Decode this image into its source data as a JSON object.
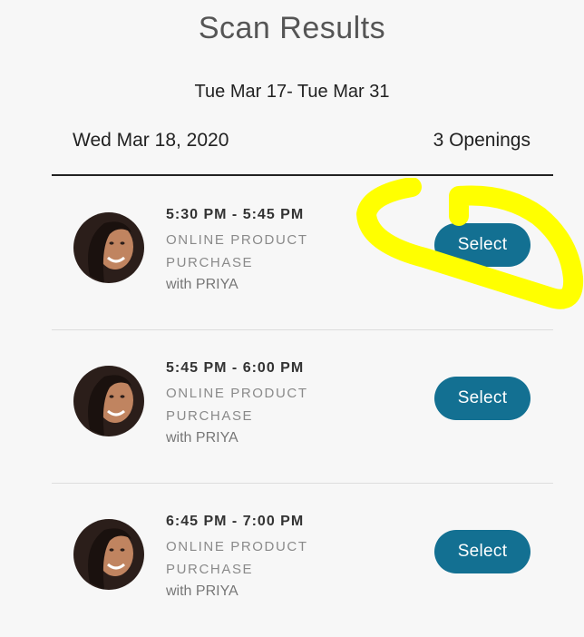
{
  "header": {
    "title": "Scan Results",
    "date_range": "Tue Mar 17- Tue Mar 31"
  },
  "day": {
    "date": "Wed Mar 18, 2020",
    "openings": "3 Openings"
  },
  "slots": [
    {
      "time": "5:30 PM - 5:45 PM",
      "service_line1": "ONLINE PRODUCT",
      "service_line2": "PURCHASE",
      "with": "with PRIYA",
      "button": "Select"
    },
    {
      "time": "5:45 PM - 6:00 PM",
      "service_line1": "ONLINE PRODUCT",
      "service_line2": "PURCHASE",
      "with": "with PRIYA",
      "button": "Select"
    },
    {
      "time": "6:45 PM - 7:00 PM",
      "service_line1": "ONLINE PRODUCT",
      "service_line2": "PURCHASE",
      "with": "with PRIYA",
      "button": "Select"
    }
  ],
  "annotation": {
    "highlight_color": "#ffff00",
    "shape": "hand-drawn circle around first Select button"
  },
  "colors": {
    "button": "#137092",
    "background": "#f7f7f7"
  }
}
